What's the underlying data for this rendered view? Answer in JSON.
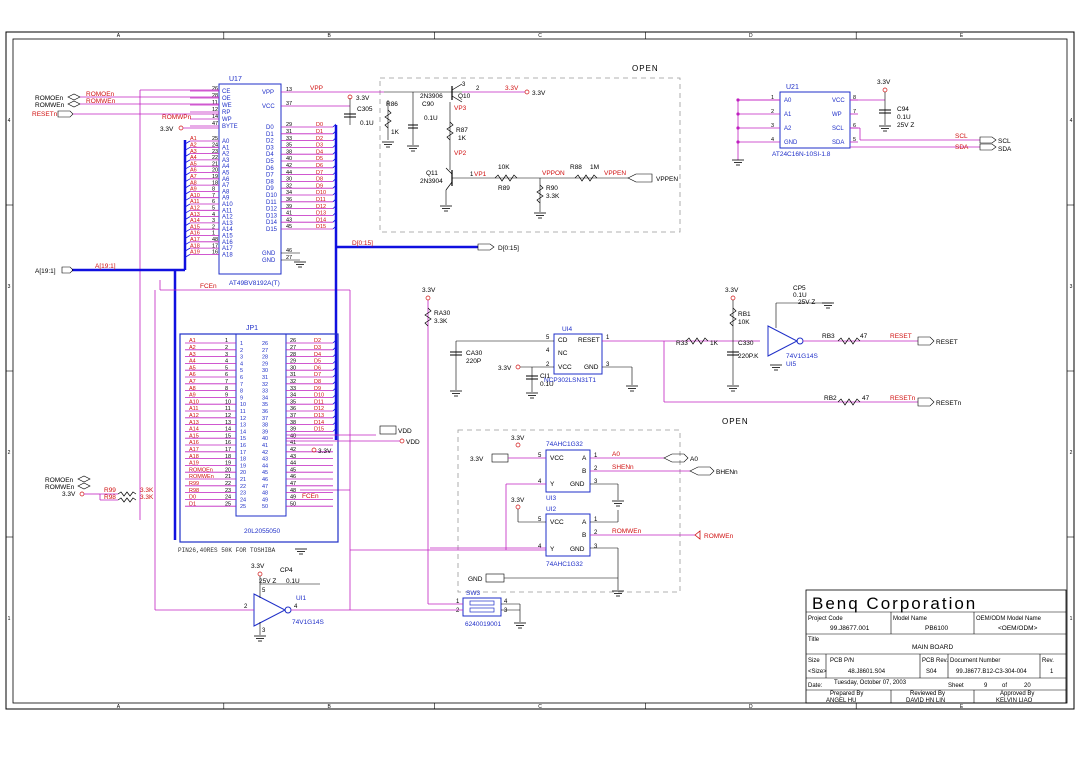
{
  "border": {
    "cols": [
      "A",
      "B",
      "C",
      "D",
      "E"
    ],
    "rows": [
      "4",
      "3",
      "2",
      "1"
    ]
  },
  "colors": {
    "blue": "#1f2fc8",
    "red": "#d01010",
    "magenta": "#c020c0",
    "green": "#108010",
    "black": "#000000",
    "bus": "#1010e0"
  },
  "u17": {
    "ref": "U17",
    "part": "AT49BV8192A(T)",
    "left_pins": [
      {
        "num": "26",
        "name": "CE",
        "net": ""
      },
      {
        "num": "28",
        "name": "OE",
        "net": "ROMOEn"
      },
      {
        "num": "11",
        "name": "WE",
        "net": "ROMWEn"
      },
      {
        "num": "12",
        "name": "RP",
        "net": ""
      },
      {
        "num": "14",
        "name": "WP",
        "net": "ROMWPn"
      },
      {
        "num": "47",
        "name": "BYTE",
        "net": ""
      },
      {
        "num": "25",
        "name": "A0",
        "net": "A1"
      },
      {
        "num": "24",
        "name": "A1",
        "net": "A2"
      },
      {
        "num": "23",
        "name": "A2",
        "net": "A3"
      },
      {
        "num": "22",
        "name": "A3",
        "net": "A4"
      },
      {
        "num": "21",
        "name": "A4",
        "net": "A5"
      },
      {
        "num": "20",
        "name": "A5",
        "net": "A6"
      },
      {
        "num": "19",
        "name": "A6",
        "net": "A7"
      },
      {
        "num": "18",
        "name": "A7",
        "net": "A8"
      },
      {
        "num": "8",
        "name": "A8",
        "net": "A9"
      },
      {
        "num": "7",
        "name": "A9",
        "net": "A10"
      },
      {
        "num": "6",
        "name": "A10",
        "net": "A11"
      },
      {
        "num": "5",
        "name": "A11",
        "net": "A12"
      },
      {
        "num": "4",
        "name": "A12",
        "net": "A13"
      },
      {
        "num": "3",
        "name": "A13",
        "net": "A14"
      },
      {
        "num": "2",
        "name": "A14",
        "net": "A15"
      },
      {
        "num": "1",
        "name": "A15",
        "net": "A16"
      },
      {
        "num": "48",
        "name": "A16",
        "net": "A17"
      },
      {
        "num": "17",
        "name": "A17",
        "net": "A18"
      },
      {
        "num": "16",
        "name": "A18",
        "net": "A19"
      }
    ],
    "right_top": [
      {
        "num": "13",
        "name": "VPP",
        "net": "VPP"
      },
      {
        "num": "37",
        "name": "VCC",
        "net": ""
      }
    ],
    "right_pins": [
      {
        "num": "29",
        "name": "D0",
        "net": "D0"
      },
      {
        "num": "31",
        "name": "D1",
        "net": "D1"
      },
      {
        "num": "33",
        "name": "D2",
        "net": "D2"
      },
      {
        "num": "35",
        "name": "D3",
        "net": "D3"
      },
      {
        "num": "38",
        "name": "D4",
        "net": "D4"
      },
      {
        "num": "40",
        "name": "D5",
        "net": "D5"
      },
      {
        "num": "42",
        "name": "D6",
        "net": "D6"
      },
      {
        "num": "44",
        "name": "D7",
        "net": "D7"
      },
      {
        "num": "30",
        "name": "D8",
        "net": "D8"
      },
      {
        "num": "32",
        "name": "D9",
        "net": "D9"
      },
      {
        "num": "34",
        "name": "D10",
        "net": "D10"
      },
      {
        "num": "36",
        "name": "D11",
        "net": "D11"
      },
      {
        "num": "39",
        "name": "D12",
        "net": "D12"
      },
      {
        "num": "41",
        "name": "D13",
        "net": "D13"
      },
      {
        "num": "43",
        "name": "D14",
        "net": "D14"
      },
      {
        "num": "45",
        "name": "D15",
        "net": "D15"
      }
    ],
    "gnd_pins": [
      {
        "num": "46",
        "name": "GND"
      },
      {
        "num": "27",
        "name": "GND"
      }
    ]
  },
  "jp1": {
    "ref": "JP1",
    "part": "20L2055050",
    "left_nets": [
      "A1",
      "A2",
      "A3",
      "A4",
      "A5",
      "A6",
      "A7",
      "A8",
      "A9",
      "A10",
      "A11",
      "A12",
      "A13",
      "A14",
      "A15",
      "A16",
      "A17",
      "A18",
      "A19",
      "ROMOEn",
      "ROMWEn",
      "R99",
      "R98",
      "D0",
      "D1"
    ],
    "left_nums": [
      "1",
      "2",
      "3",
      "4",
      "5",
      "6",
      "7",
      "8",
      "9",
      "10",
      "11",
      "12",
      "13",
      "14",
      "15",
      "16",
      "17",
      "18",
      "19",
      "20",
      "21",
      "22",
      "23",
      "24",
      "25"
    ],
    "right_nums": [
      "26",
      "27",
      "28",
      "29",
      "30",
      "31",
      "32",
      "33",
      "34",
      "35",
      "36",
      "37",
      "38",
      "39",
      "40",
      "41",
      "42",
      "43",
      "44",
      "45",
      "46",
      "47",
      "48",
      "49",
      "50"
    ],
    "right_nets": [
      "D2",
      "D3",
      "D4",
      "D5",
      "D6",
      "D7",
      "D8",
      "D9",
      "D10",
      "D11",
      "D12",
      "D13",
      "D14",
      "D15",
      "",
      "",
      "",
      "",
      "",
      "",
      "",
      "FCEn",
      "",
      "",
      ""
    ]
  },
  "labels": {
    "romoen": "ROMOEn",
    "romwen": "ROMWEn",
    "resetn": "RESETn",
    "v33": "3.3V",
    "abus": "A[19:1]",
    "abus_inner": "A[19:1]",
    "dbus": "D[0:15]",
    "dbus_out": "D[0:15]",
    "fcen": "FCEn",
    "vpp": "VPP",
    "vpp2": "VPP",
    "vdd": "VDD",
    "vdd2": "VDD",
    "v33b": "3.3V",
    "romoen2": "ROMOEn",
    "romwen2": "ROMWEn",
    "v33c": "3.3V",
    "r99": "R99",
    "r98": "R98",
    "r99v": "3.3K",
    "r98v": "3.3K",
    "toshiba": "PIN26,40RES 50K FOR TOSHIBA",
    "open1": "OPEN",
    "open2": "OPEN",
    "gnd": "GND",
    "reset": "RESET",
    "resetn2": "RESETn",
    "a0": "A0",
    "bhenn": "BHENn",
    "romwen3": "ROMWEn",
    "vppen": "VPPEN",
    "shenn": "SHENn",
    "romwen4": "ROMWEn",
    "sda": "SDA",
    "scl": "SCL",
    "sda2": "SDA",
    "scl2": "SCL"
  },
  "vpp_circuit": {
    "r86": "R86",
    "r86v": "1K",
    "c90": "C90",
    "c90v": "0.1U",
    "q10": "Q10",
    "q10p": "2N3906",
    "vp3": "VP3",
    "r87": "R87",
    "r87v": "1K",
    "vp2": "VP2",
    "q11": "Q11",
    "q11p": "2N3904",
    "vp1": "VP1",
    "r10k": "10K",
    "r89": "R89",
    "vppon": "VPPON",
    "r88": "R88",
    "r88v": "1M",
    "r90": "R90",
    "r90v": "3.3K",
    "c305": "C305",
    "c305v": "0.1U",
    "v33": "3.3V",
    "v33b": "3.3V",
    "v33c": "3.3V",
    "p3": "3",
    "p2": "2",
    "p1": "1"
  },
  "u21": {
    "ref": "U21",
    "part": "AT24C16N-10SI-1.8",
    "left": [
      {
        "num": "1",
        "name": "A0"
      },
      {
        "num": "2",
        "name": "A1"
      },
      {
        "num": "3",
        "name": "A2"
      },
      {
        "num": "4",
        "name": "GND"
      }
    ],
    "right": [
      {
        "num": "8",
        "name": "VCC"
      },
      {
        "num": "7",
        "name": "WP"
      },
      {
        "num": "6",
        "name": "SCL"
      },
      {
        "num": "5",
        "name": "SDA"
      }
    ],
    "v33": "3.3V",
    "c94": "C94",
    "c94v": "0.1U",
    "c94r": "25V Z"
  },
  "reset_circuit": {
    "ra30": "RA30",
    "ra30v": "3.3K",
    "v33": "3.3V",
    "u14": "UI4",
    "u14p": "NCP302LSN31T1",
    "cd": "CD",
    "rst": "RESET",
    "nc": "NC",
    "vcc": "VCC",
    "gnd": "GND",
    "p5": "5",
    "p4": "4",
    "p2": "2",
    "p3": "3",
    "p1": "1",
    "ca30": "CA30",
    "ca30v": "220P",
    "ci1": "CI1",
    "ci1v": "0.1U",
    "v33b": "3.3V",
    "r33": "R33",
    "r33v": "1K",
    "rb1": "RB1",
    "rb1v": "10K",
    "c330": "C330",
    "c330v": "220P.K",
    "v33c": "3.3V",
    "cp5": "CP5",
    "cp5v": "0.1U",
    "cp5r": "25V Z",
    "u15": "74V1G14S",
    "u15r": "UI5",
    "rb3": "RB3",
    "rb3v": "47",
    "rb2": "RB2",
    "rb2v": "47"
  },
  "gates": {
    "u13": "UI3",
    "u12": "UI2",
    "part": "74AHC1G32",
    "vcc": "VCC",
    "a": "A",
    "b": "B",
    "y": "Y",
    "gnd": "GND",
    "v33": "3.3V",
    "v33b": "3.3V",
    "v33c": "3.3V",
    "p5": "5",
    "p1": "1",
    "p2": "2",
    "p3": "3",
    "p4": "4"
  },
  "sw3": {
    "ref": "SW3",
    "part": "6240019001",
    "p1": "1",
    "p2": "2",
    "p3": "3",
    "p4": "4"
  },
  "u11": {
    "ref": "UI1",
    "part": "74V1G14S",
    "cp4": "CP4",
    "cp4v": "0.1U",
    "cp4r": "25V Z",
    "v33": "3.3V",
    "p2": "2",
    "p4": "4",
    "p3": "3",
    "p5": "5"
  },
  "titleblock": {
    "company": "Benq Corporation",
    "project_code_label": "Project Code",
    "project_code": "99.J8677.001",
    "model_name_label": "Model Name",
    "model_name": "PB6100",
    "oem_label": "OEM/ODM Model Name",
    "oem": "<OEM/ODM>",
    "title_label": "Title",
    "title": "MAIN BOARD",
    "size_label": "Size",
    "size": "<Size>",
    "pcb_pn_label": "PCB P/N",
    "pcb_pn": "48.J8601.S04",
    "pcb_rev_label": "PCB Rev.",
    "pcb_rev": "S04",
    "doc_label": "Document Number",
    "doc": "99.J8677.B12-C3-304-004",
    "rev_label": "Rev.",
    "rev": "1",
    "date_label": "Date:",
    "date": "Tuesday, October 07, 2003",
    "sheet_label": "Sheet",
    "sheet": "9",
    "of": "of",
    "sheets": "20",
    "prepared_label": "Prepared By",
    "prepared": "ANGEL HU",
    "reviewed_label": "Reviewed By",
    "reviewed": "DAVID HN LIN",
    "approved_label": "Approved By",
    "approved": "KELVIN LIAO"
  }
}
